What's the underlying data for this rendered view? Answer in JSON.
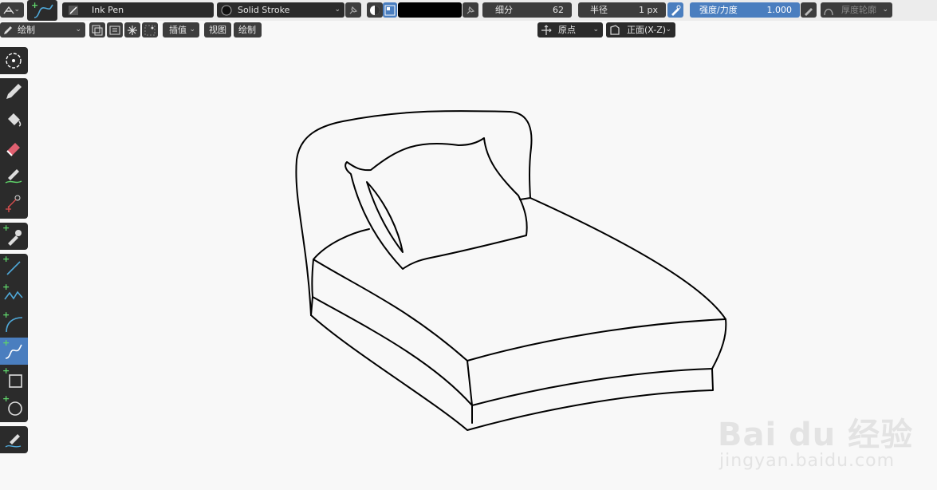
{
  "header": {
    "brush_name": "Ink Pen",
    "material": "Solid Stroke",
    "subdivide_label": "细分",
    "subdivide_value": "62",
    "radius_label": "半径",
    "radius_value": "1 px",
    "strength_label": "强度/力度",
    "strength_value": "1.000",
    "thickness_label": "厚度轮廓",
    "stroke_color": "#000000"
  },
  "header2": {
    "mode": "绘制",
    "interpolate": "插值",
    "view_label": "视图",
    "draw_label": "绘制",
    "origin": "原点",
    "orientation": "正面(X-Z)"
  },
  "toolbar": {
    "tools": [
      "cursor",
      "draw",
      "fill",
      "erase",
      "tint",
      "cutter",
      "eyedropper",
      "line",
      "polyline",
      "arc",
      "curve",
      "box",
      "circle",
      "annotate"
    ],
    "active_tool": "curve"
  },
  "watermark": {
    "main": "Bai du 经验",
    "sub": "jingyan.baidu.com"
  },
  "colors": {
    "accent": "#4a7ebf",
    "panel": "#2b2b2b",
    "canvas": "#f8f8f8"
  }
}
